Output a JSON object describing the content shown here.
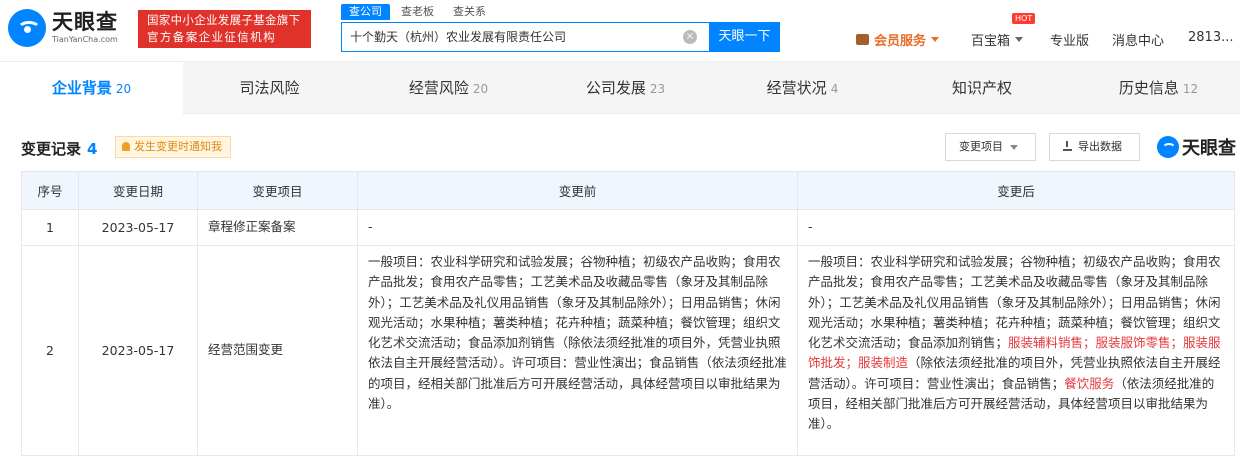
{
  "header": {
    "logo_cn": "天眼查",
    "logo_en": "TianYanCha.com",
    "slogan_line1": "国家中小企业发展子基金旗下",
    "slogan_line2": "官方备案企业征信机构",
    "search_tabs": [
      "查公司",
      "查老板",
      "查关系"
    ],
    "search_value": "十个勤天（杭州）农业发展有限责任公司",
    "search_button": "天眼一下",
    "vip": "会员服务",
    "baobaoxiang": "百宝箱",
    "hot_badge": "HOT",
    "pro": "专业版",
    "messages": "消息中心",
    "user": "2813..."
  },
  "tabs": [
    {
      "label": "企业背景",
      "count": "20"
    },
    {
      "label": "司法风险",
      "count": ""
    },
    {
      "label": "经营风险",
      "count": "20"
    },
    {
      "label": "公司发展",
      "count": "23"
    },
    {
      "label": "经营状况",
      "count": "4"
    },
    {
      "label": "知识产权",
      "count": ""
    },
    {
      "label": "历史信息",
      "count": "12"
    }
  ],
  "section": {
    "title": "变更记录",
    "count": "4",
    "notify": "发生变更时通知我",
    "filter": "变更项目",
    "export": "导出数据",
    "brand": "天眼查"
  },
  "table": {
    "headers": [
      "序号",
      "变更日期",
      "变更项目",
      "变更前",
      "变更后"
    ],
    "row1": {
      "no": "1",
      "date": "2023-05-17",
      "item": "章程修正案备案",
      "before": "-",
      "after": "-"
    },
    "row2": {
      "no": "2",
      "date": "2023-05-17",
      "item": "经营范围变更",
      "before": "一般项目：农业科学研究和试验发展；谷物种植；初级农产品收购；食用农产品批发；食用农产品零售；工艺美术品及收藏品零售（象牙及其制品除外）；工艺美术品及礼仪用品销售（象牙及其制品除外）；日用品销售；休闲观光活动；水果种植；薯类种植；花卉种植；蔬菜种植；餐饮管理；组织文化艺术交流活动；食品添加剂销售（除依法须经批准的项目外，凭营业执照依法自主开展经营活动）。许可项目：营业性演出；食品销售（依法须经批准的项目，经相关部门批准后方可开展经营活动，具体经营项目以审批结果为准）。",
      "after_a": "一般项目：农业科学研究和试验发展；谷物种植；初级农产品收购；食用农产品批发；食用农产品零售；工艺美术品及收藏品零售（象牙及其制品除外）；工艺美术品及礼仪用品销售（象牙及其制品除外）；日用品销售；休闲观光活动；水果种植；薯类种植；花卉种植；蔬菜种植；餐饮管理；组织文化艺术交流活动；食品添加剂销售；",
      "after_red1": "服装辅料销售；服装服饰零售；服装服饰批发；服装制造",
      "after_b": "（除依法须经批准的项目外，凭营业执照依法自主开展经营活动）。许可项目：营业性演出；食品销售；",
      "after_red2": "餐饮服务",
      "after_c": "（依法须经批准的项目，经相关部门批准后方可开展经营活动，具体经营项目以审批结果为准）。"
    }
  },
  "colors": {
    "accent": "#0084ff",
    "slogan_bg": "#e0312b",
    "highlight": "#e4393c",
    "vip": "#e86c2a"
  }
}
